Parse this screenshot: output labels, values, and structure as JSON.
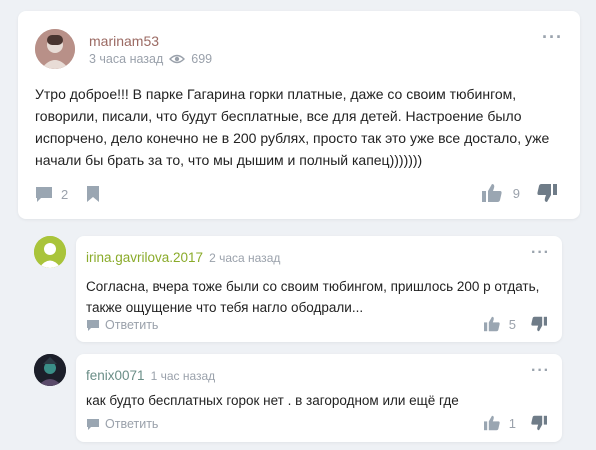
{
  "post": {
    "username": "marinam53",
    "time": "3 часа назад",
    "views": "699",
    "text": "Утро доброе!!! В парке Гагарина горки платные, даже со своим тюбингом, говорили, писали, что будут бесплатные, все для детей. Настроение было испорчено, дело конечно не в 200 рублях, просто так это уже все достало, уже начали бы брать за то, что мы дышим и полный капец)))))))",
    "comments_count": "2",
    "likes": "9",
    "more_icon": "more-dots-icon",
    "view_icon": "eye-icon"
  },
  "replies": [
    {
      "username": "irina.gavrilova.2017",
      "time": "2 часа назад",
      "text": "Согласна, вчера тоже были со своим тюбингом, пришлось 200 р отдать, также ощущение что тебя нагло ободрали...",
      "reply_label": "Ответить",
      "likes": "5"
    },
    {
      "username": "fenix0071",
      "time": "1 час назад",
      "text": "как будто бесплатных горок нет . в загородном или ещё где",
      "reply_label": "Ответить",
      "likes": "1"
    }
  ],
  "colors": {
    "background": "#eef1f5",
    "post_username": "#9b6a63",
    "reply1_username": "#8aab2a",
    "reply2_username": "#6a8e87",
    "muted": "#9aa1ab"
  }
}
